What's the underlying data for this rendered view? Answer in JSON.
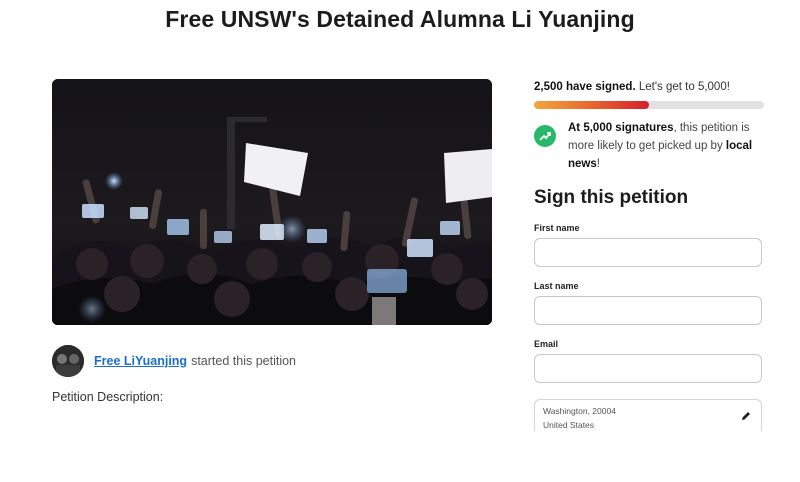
{
  "page": {
    "title": "Free UNSW's Detained Alumna Li Yuanjing"
  },
  "starter": {
    "name": "Free LiYuanjing",
    "action": "started this petition",
    "avatar_icon": "avatar-photo"
  },
  "description": {
    "label": "Petition Description:"
  },
  "signatures": {
    "count": "2,500 have signed.",
    "goal_text": "Let's get to 5,000!",
    "progress": 0.5,
    "progress_colors": [
      "#f1a73c",
      "#e8662f",
      "#d61e2e"
    ]
  },
  "milestone": {
    "icon": "trending-up-icon",
    "icon_color": "#27b86a",
    "strong1": "At 5,000 signatures",
    "text1": ", this petition is more likely to get picked up by ",
    "strong2": "local news",
    "text2": "!"
  },
  "form": {
    "title": "Sign this petition",
    "first_name_label": "First name",
    "first_name_value": "",
    "last_name_label": "Last name",
    "last_name_value": "",
    "email_label": "Email",
    "email_value": "",
    "address_line1": "Washington, 20004",
    "address_line2": "United States",
    "edit_icon": "pencil-icon"
  }
}
